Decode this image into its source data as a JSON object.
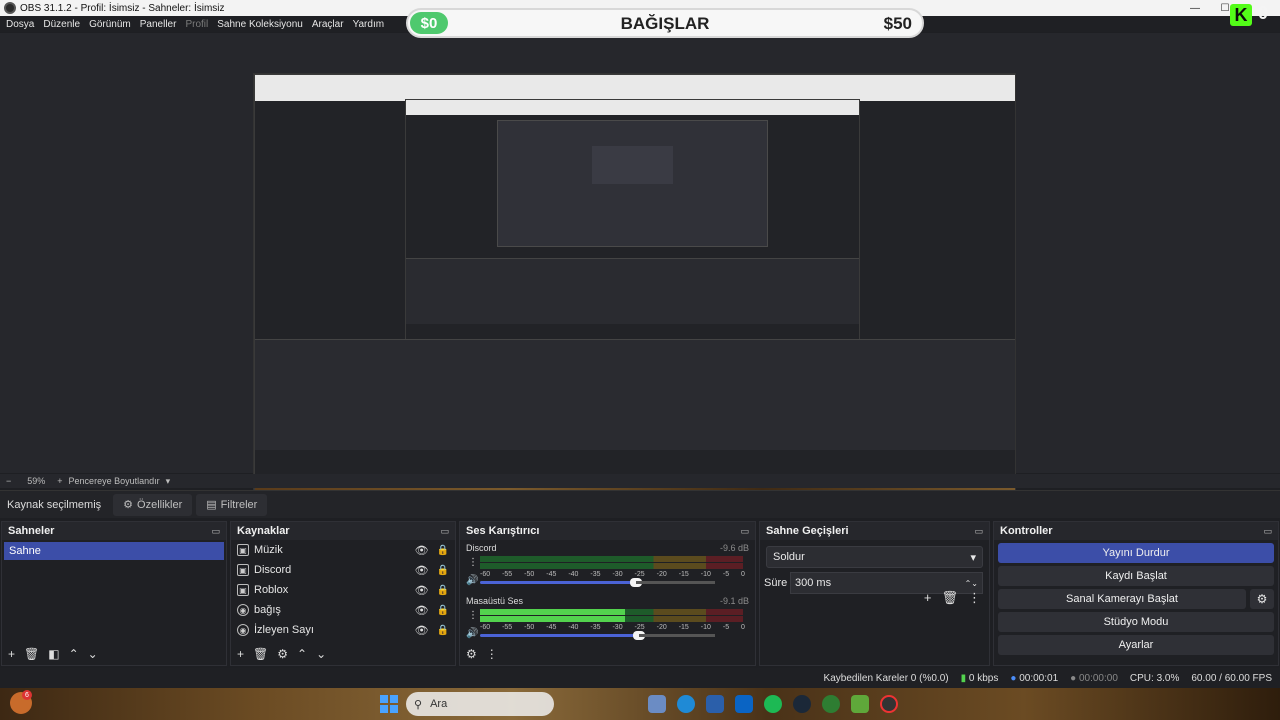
{
  "window": {
    "title": "OBS 31.1.2 - Profil: İsimsiz - Sahneler: İsimsiz",
    "controls": {
      "minimize": "—",
      "maximize": "☐",
      "close": "✕"
    }
  },
  "menu": [
    "Dosya",
    "Düzenle",
    "Görünüm",
    "Paneller",
    "Profil",
    "Sahne Koleksiyonu",
    "Araçlar",
    "Yardım"
  ],
  "banner": {
    "current": "$0",
    "title": "BAĞIŞLAR",
    "goal": "$50"
  },
  "kick": {
    "letter": "K",
    "count": "0"
  },
  "zoom": {
    "minus": "−",
    "value": "59%",
    "plus": "+",
    "mode": "Pencereye Boyutlandır"
  },
  "source_bar": {
    "status": "Kaynak seçilmemiş",
    "properties": "Özellikler",
    "filters": "Filtreler"
  },
  "scenes": {
    "title": "Sahneler",
    "items": [
      "Sahne"
    ]
  },
  "sources": {
    "title": "Kaynaklar",
    "items": [
      {
        "name": "Müzik",
        "icon": "window-capture-icon"
      },
      {
        "name": "Discord",
        "icon": "window-capture-icon"
      },
      {
        "name": "Roblox",
        "icon": "window-capture-icon"
      },
      {
        "name": "bağış",
        "icon": "browser-source-icon"
      },
      {
        "name": "İzleyen Sayı",
        "icon": "browser-source-icon"
      }
    ]
  },
  "mixer": {
    "title": "Ses Karıştırıcı",
    "channels": [
      {
        "name": "Discord",
        "db": "-9.6 dB",
        "level": 0,
        "fader": 0.92
      },
      {
        "name": "Masaüstü Ses",
        "db": "-9.1 dB",
        "level": 0.55,
        "fader": 0.94
      }
    ],
    "ticks": [
      "-60",
      "-55",
      "-50",
      "-45",
      "-40",
      "-35",
      "-30",
      "-25",
      "-20",
      "-15",
      "-10",
      "-5",
      "0"
    ]
  },
  "transitions": {
    "title": "Sahne Geçişleri",
    "selected": "Soldur",
    "duration_label": "Süre",
    "duration": "300 ms"
  },
  "controls": {
    "title": "Kontroller",
    "stop_stream": "Yayını Durdur",
    "start_record": "Kaydı Başlat",
    "virtual_cam": "Sanal Kamerayı Başlat",
    "studio_mode": "Stüdyo Modu",
    "settings": "Ayarlar"
  },
  "status": {
    "dropped": "Kaybedilen Kareler 0 (%0.0)",
    "bitrate": "0 kbps",
    "stream_time": "00:00:01",
    "record_time": "00:00:00",
    "cpu": "CPU: 3.0%",
    "fps": "60.00 / 60.00 FPS"
  },
  "taskbar": {
    "search_placeholder": "Ara",
    "weather_badge": "6"
  },
  "colors": {
    "accent": "#3c4ea8",
    "meter_green": "#53d34e",
    "kick": "#53fc18"
  }
}
